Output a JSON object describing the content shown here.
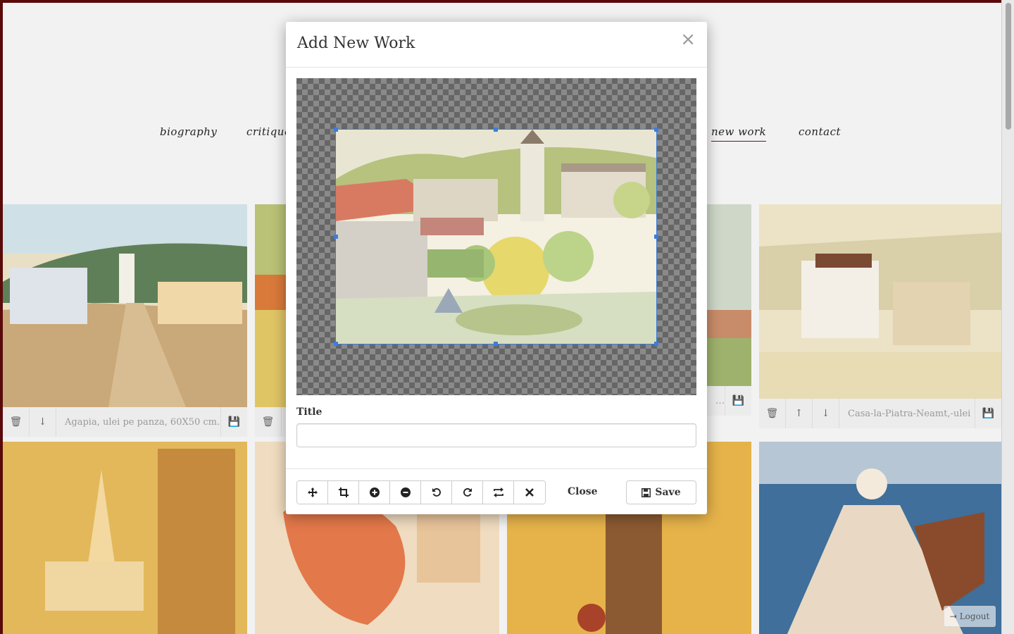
{
  "nav": {
    "items": [
      "biography",
      "critique",
      "new work",
      "contact"
    ],
    "active": "new work"
  },
  "gallery": {
    "captions": [
      "Agapia, ulei pe panza, 60X50 cm.",
      "Casa-la-Piatra-Neamt,-ulei",
      "…m."
    ]
  },
  "modal": {
    "title": "Add New Work",
    "close_symbol": "×",
    "field_label": "Title",
    "title_value": "",
    "title_placeholder": "",
    "tools": [
      {
        "name": "move-icon",
        "glyph": "✥"
      },
      {
        "name": "crop-icon",
        "glyph": "⌗"
      },
      {
        "name": "zoom-in-icon",
        "glyph": "+"
      },
      {
        "name": "zoom-out-icon",
        "glyph": "−"
      },
      {
        "name": "rotate-left-icon",
        "glyph": "↺"
      },
      {
        "name": "rotate-right-icon",
        "glyph": "↻"
      },
      {
        "name": "flip-icon",
        "glyph": "⇄"
      },
      {
        "name": "cancel-icon",
        "glyph": "✖"
      }
    ],
    "close_label": "Close",
    "save_label": "Save"
  },
  "logout_label": "Logout",
  "colors": {
    "accent": "#3b7ddd",
    "frame": "#5a0a0a",
    "nav_underline": "#7a1010"
  }
}
